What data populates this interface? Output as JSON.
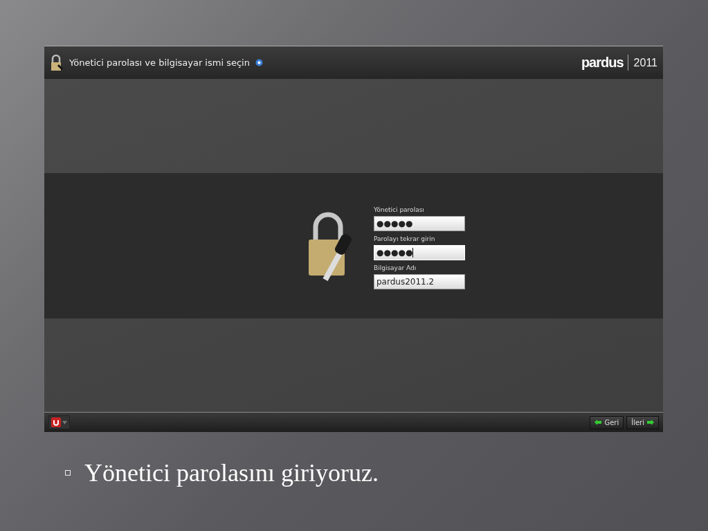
{
  "window": {
    "title": "Yönetici parolası ve bilgisayar ismi seçin",
    "logo": "pardus",
    "year": "2011"
  },
  "form": {
    "fields": [
      {
        "label": "Yönetici parolası",
        "value": "●●●●●",
        "focused": false
      },
      {
        "label": "Parolayı tekrar girin",
        "value": "●●●●●",
        "focused": true
      },
      {
        "label": "Bilgisayar Adı",
        "value": "pardus2011.2",
        "focused": false
      }
    ]
  },
  "footer": {
    "buttons": [
      {
        "label": "Geri",
        "kind": "back"
      },
      {
        "label": "İleri",
        "kind": "next"
      }
    ]
  },
  "bullets": [
    "Yönetici parolasını giriyoruz."
  ]
}
